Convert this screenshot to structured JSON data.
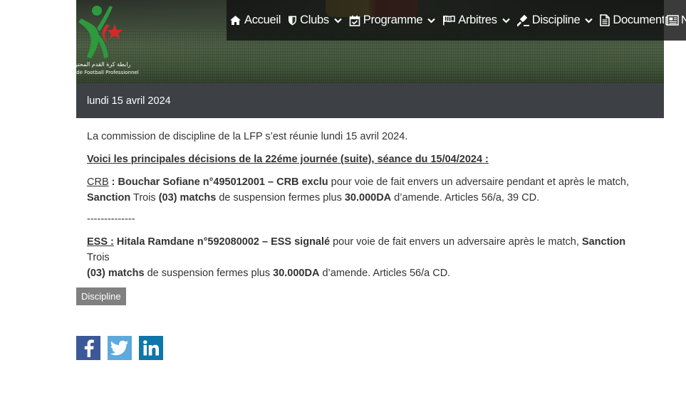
{
  "header": {
    "logo": {
      "arabic_text": "رابطة كرة القدم المحترف",
      "latin_text": "Ligue de Football Professionnel"
    },
    "nav": [
      {
        "label": "Accueil",
        "icon": "home-icon",
        "dropdown": false
      },
      {
        "label": "Clubs",
        "icon": "shield-icon",
        "dropdown": true
      },
      {
        "label": "Programme",
        "icon": "calendar-check-icon",
        "dropdown": true
      },
      {
        "label": "Arbitres",
        "icon": "flag-icon",
        "dropdown": true
      },
      {
        "label": "Discipline",
        "icon": "gavel-icon",
        "dropdown": true
      },
      {
        "label": "Documents",
        "icon": "document-icon",
        "dropdown": true
      }
    ],
    "nav_overflow_label": "N",
    "nav_overflow_icon": "newspaper-icon"
  },
  "date_bar": {
    "label": "lundi 15 avril 2024"
  },
  "article": {
    "intro": "La commission de discipline de la LFP s’est réunie lundi 15 avril 2024.",
    "heading": "Voici les principales décisions de la 22éme journée (suite), séance du 15/04/2024 :",
    "decision1": {
      "club": "CRB",
      "colon": " : ",
      "subject": "Bouchar Sofiane n°495012001 – CRB exclu",
      "reason": " pour voie de fait envers un adversaire pendant et après le match,",
      "sanction_label": "Sanction",
      "sanction_count_text": " Trois ",
      "sanction_count": "(03) matchs",
      "sanction_text": " de suspension fermes plus ",
      "fine": "30.000DA",
      "articles": " d’amende. Articles 56/a, 39 CD."
    },
    "separator": "--------------",
    "decision2": {
      "club": "ESS :",
      "subject": " Hitala Ramdane n°592080002 – ESS signalé",
      "reason": " pour voie de fait envers un adversaire après le match, ",
      "sanction_label": "Sanction",
      "sanction_count_text": " Trois",
      "sanction_count": "(03) matchs",
      "sanction_text": " de suspension fermes plus ",
      "fine": "30.000DA",
      "articles": " d’amende. Articles 56/a CD."
    }
  },
  "tag": {
    "label": "Discipline"
  },
  "share": [
    {
      "network": "facebook",
      "icon": "facebook-icon",
      "color": "#3b5998"
    },
    {
      "network": "twitter",
      "icon": "twitter-icon",
      "color": "#5ea9dd"
    },
    {
      "network": "linkedin",
      "icon": "linkedin-icon",
      "color": "#0e76a8"
    }
  ],
  "colors": {
    "nav_background": "#121412",
    "date_bar_background": "#3d4145",
    "tag_background": "#808080",
    "text": "#333333",
    "logo_green": "#2e9a3e",
    "logo_red": "#d42a2a"
  }
}
